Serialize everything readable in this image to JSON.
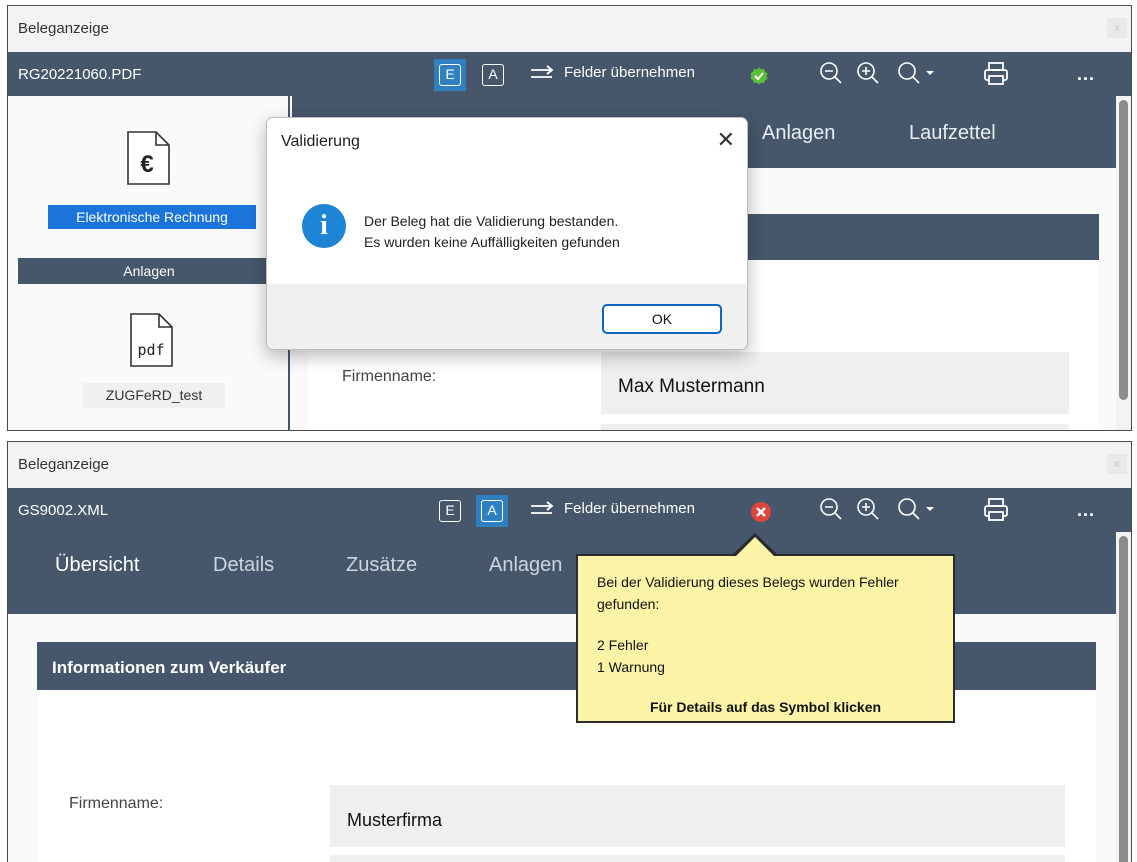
{
  "panel_a": {
    "window_title": "Beleganzeige",
    "close_glyph": "x",
    "filename": "RG20221060.PDF",
    "mode_e": "E",
    "mode_a": "A",
    "felder_label": "Felder übernehmen",
    "more_label": "...",
    "sidebar": {
      "selected_label": "Elektronische Rechnung",
      "section_label": "Anlagen",
      "attachment_label": "ZUGFeRD_test",
      "pdf_glyph": "pdf",
      "euro_glyph": "€"
    },
    "tabs": [
      "Anlagen",
      "Laufzettel"
    ],
    "field_label": "Firmenname:",
    "field_value": "Max Mustermann",
    "dialog": {
      "title": "Validierung",
      "close_glyph": "✕",
      "info_glyph": "i",
      "message_line1": "Der Beleg hat die Validierung bestanden.",
      "message_line2": "Es wurden keine Auffälligkeiten gefunden",
      "ok_label": "OK"
    }
  },
  "panel_b": {
    "window_title": "Beleganzeige",
    "close_glyph": "x",
    "filename": "GS9002.XML",
    "mode_e": "E",
    "mode_a": "A",
    "felder_label": "Felder übernehmen",
    "more_label": "...",
    "tabs": [
      "Übersicht",
      "Details",
      "Zusätze",
      "Anlagen"
    ],
    "section_title": "Informationen zum Verkäufer",
    "field_label": "Firmenname:",
    "field_value": "Musterfirma",
    "tooltip": {
      "line1": "Bei der Validierung dieses Belegs wurden Fehler gefunden:",
      "line3": "2 Fehler",
      "line4": "1 Warnung",
      "line5": "Für Details auf das Symbol klicken"
    }
  },
  "colors": {
    "toolbar": "#46576b",
    "accent_blue": "#2f7fc1",
    "selection": "#1a74d9",
    "success": "#5bbd3a",
    "error": "#e0463c",
    "tooltip_bg": "#fbf4a7"
  }
}
